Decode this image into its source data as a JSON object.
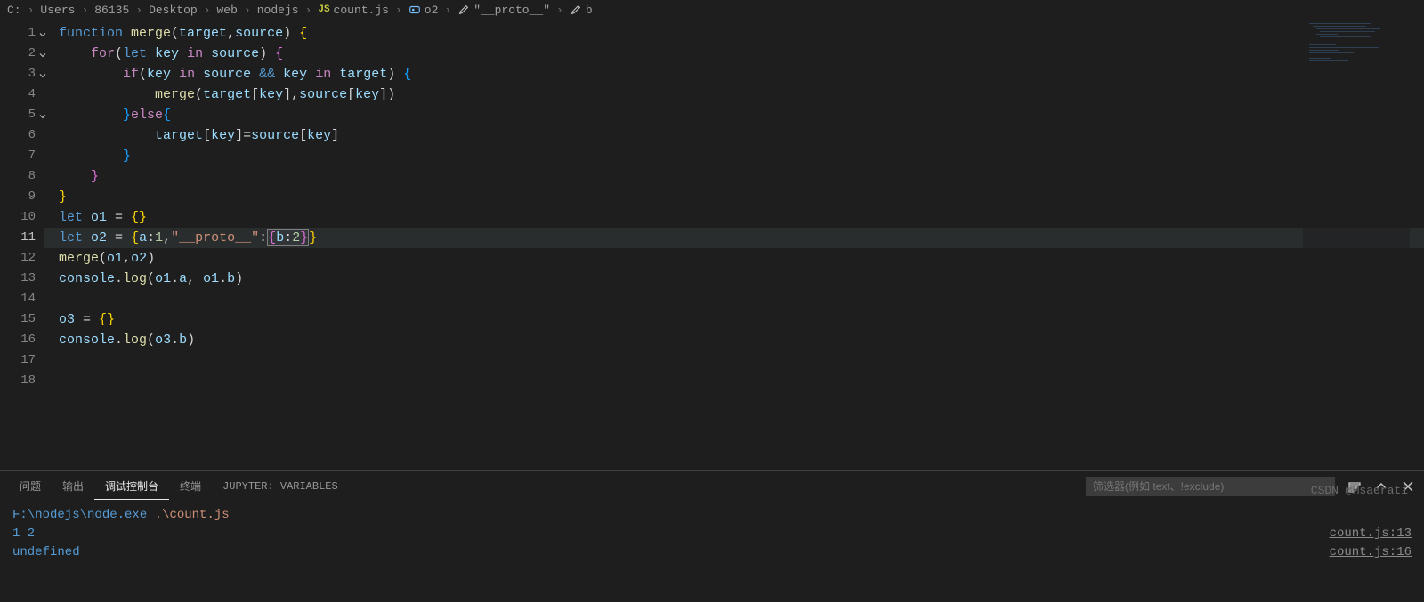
{
  "breadcrumb": {
    "parts": [
      "C:",
      "Users",
      "86135",
      "Desktop",
      "web",
      "nodejs"
    ],
    "file": "count.js",
    "symbols": [
      {
        "icon": "var",
        "label": "o2"
      },
      {
        "icon": "wrench",
        "label": "\"__proto__\""
      },
      {
        "icon": "wrench",
        "label": "b"
      }
    ]
  },
  "editor": {
    "active_line": 11,
    "lines": [
      {
        "n": 1,
        "fold": true,
        "tokens": [
          [
            "kw",
            "function "
          ],
          [
            "fn",
            "merge"
          ],
          [
            "pun",
            "("
          ],
          [
            "var",
            "target"
          ],
          [
            "pun",
            ","
          ],
          [
            "var",
            "source"
          ],
          [
            "pun",
            ") "
          ],
          [
            "brc-y",
            "{"
          ]
        ]
      },
      {
        "n": 2,
        "fold": true,
        "tokens": [
          [
            "pun",
            "    "
          ],
          [
            "kw2",
            "for"
          ],
          [
            "pun",
            "("
          ],
          [
            "kw",
            "let "
          ],
          [
            "var",
            "key"
          ],
          [
            "pun",
            " "
          ],
          [
            "kw2",
            "in"
          ],
          [
            "pun",
            " "
          ],
          [
            "var",
            "source"
          ],
          [
            "pun",
            ") "
          ],
          [
            "brc-p",
            "{"
          ]
        ]
      },
      {
        "n": 3,
        "fold": true,
        "tokens": [
          [
            "pun",
            "        "
          ],
          [
            "kw2",
            "if"
          ],
          [
            "pun",
            "("
          ],
          [
            "var",
            "key"
          ],
          [
            "pun",
            " "
          ],
          [
            "kw2",
            "in"
          ],
          [
            "pun",
            " "
          ],
          [
            "var",
            "source"
          ],
          [
            "pun",
            " "
          ],
          [
            "kw",
            "&&"
          ],
          [
            "pun",
            " "
          ],
          [
            "var",
            "key"
          ],
          [
            "pun",
            " "
          ],
          [
            "kw2",
            "in"
          ],
          [
            "pun",
            " "
          ],
          [
            "var",
            "target"
          ],
          [
            "pun",
            ") "
          ],
          [
            "brc-b",
            "{"
          ]
        ]
      },
      {
        "n": 4,
        "tokens": [
          [
            "pun",
            "            "
          ],
          [
            "fn",
            "merge"
          ],
          [
            "pun",
            "("
          ],
          [
            "var",
            "target"
          ],
          [
            "pun",
            "["
          ],
          [
            "var",
            "key"
          ],
          [
            "pun",
            "],"
          ],
          [
            "var",
            "source"
          ],
          [
            "pun",
            "["
          ],
          [
            "var",
            "key"
          ],
          [
            "pun",
            "])"
          ]
        ]
      },
      {
        "n": 5,
        "fold": true,
        "tokens": [
          [
            "pun",
            "        "
          ],
          [
            "brc-b",
            "}"
          ],
          [
            "kw2",
            "else"
          ],
          [
            "brc-b",
            "{"
          ]
        ]
      },
      {
        "n": 6,
        "tokens": [
          [
            "pun",
            "            "
          ],
          [
            "var",
            "target"
          ],
          [
            "pun",
            "["
          ],
          [
            "var",
            "key"
          ],
          [
            "pun",
            "]="
          ],
          [
            "var",
            "source"
          ],
          [
            "pun",
            "["
          ],
          [
            "var",
            "key"
          ],
          [
            "pun",
            "]"
          ]
        ]
      },
      {
        "n": 7,
        "tokens": [
          [
            "pun",
            "        "
          ],
          [
            "brc-b",
            "}"
          ]
        ]
      },
      {
        "n": 8,
        "tokens": [
          [
            "pun",
            "    "
          ],
          [
            "brc-p",
            "}"
          ]
        ]
      },
      {
        "n": 9,
        "tokens": [
          [
            "brc-y",
            "}"
          ]
        ]
      },
      {
        "n": 10,
        "tokens": [
          [
            "kw",
            "let "
          ],
          [
            "var",
            "o1"
          ],
          [
            "pun",
            " = "
          ],
          [
            "brc-y",
            "{}"
          ]
        ]
      },
      {
        "n": 11,
        "hl": true,
        "tokens": [
          [
            "kw",
            "let "
          ],
          [
            "var",
            "o2"
          ],
          [
            "pun",
            " = "
          ],
          [
            "brc-y",
            "{"
          ],
          [
            "var",
            "a"
          ],
          [
            "pun",
            ":"
          ],
          [
            "num",
            "1"
          ],
          [
            "pun",
            ","
          ],
          [
            "str",
            "\"__proto__\""
          ],
          [
            "pun",
            ":"
          ],
          [
            "sel_open",
            ""
          ],
          [
            "brc-p",
            "{"
          ],
          [
            "var",
            "b"
          ],
          [
            "pun",
            ":"
          ],
          [
            "num",
            "2"
          ],
          [
            "brc-p",
            "}"
          ],
          [
            "sel_close",
            ""
          ],
          [
            "brc-y",
            "}"
          ]
        ]
      },
      {
        "n": 12,
        "tokens": [
          [
            "fn",
            "merge"
          ],
          [
            "pun",
            "("
          ],
          [
            "var",
            "o1"
          ],
          [
            "pun",
            ","
          ],
          [
            "var",
            "o2"
          ],
          [
            "pun",
            ")"
          ]
        ]
      },
      {
        "n": 13,
        "tokens": [
          [
            "var",
            "console"
          ],
          [
            "pun",
            "."
          ],
          [
            "fn",
            "log"
          ],
          [
            "pun",
            "("
          ],
          [
            "var",
            "o1"
          ],
          [
            "pun",
            "."
          ],
          [
            "var",
            "a"
          ],
          [
            "pun",
            ", "
          ],
          [
            "var",
            "o1"
          ],
          [
            "pun",
            "."
          ],
          [
            "var",
            "b"
          ],
          [
            "pun",
            ")"
          ]
        ]
      },
      {
        "n": 14,
        "tokens": []
      },
      {
        "n": 15,
        "tokens": [
          [
            "var",
            "o3"
          ],
          [
            "pun",
            " = "
          ],
          [
            "brc-y",
            "{}"
          ]
        ]
      },
      {
        "n": 16,
        "tokens": [
          [
            "var",
            "console"
          ],
          [
            "pun",
            "."
          ],
          [
            "fn",
            "log"
          ],
          [
            "pun",
            "("
          ],
          [
            "var",
            "o3"
          ],
          [
            "pun",
            "."
          ],
          [
            "var",
            "b"
          ],
          [
            "pun",
            ")"
          ]
        ]
      },
      {
        "n": 17,
        "tokens": []
      },
      {
        "n": 18,
        "tokens": []
      }
    ]
  },
  "panel": {
    "tabs": {
      "problems": "问题",
      "output": "输出",
      "debug_console": "调试控制台",
      "terminal": "终端",
      "jupyter": "JUPYTER: VARIABLES"
    },
    "active_tab": "debug_console",
    "filter_placeholder": "筛选器(例如 text、!exclude)",
    "output": {
      "cmd_path": "F:\\nodejs\\node.exe",
      "cmd_arg": " .\\count.js",
      "lines": [
        {
          "text": "1 2",
          "loc": "count.js:13"
        },
        {
          "text": "undefined",
          "loc": "count.js:16"
        }
      ]
    }
  },
  "watermark": "CSDN @Msaerati",
  "icons": {
    "js_color": "#cbcb41",
    "chevron": "›"
  }
}
